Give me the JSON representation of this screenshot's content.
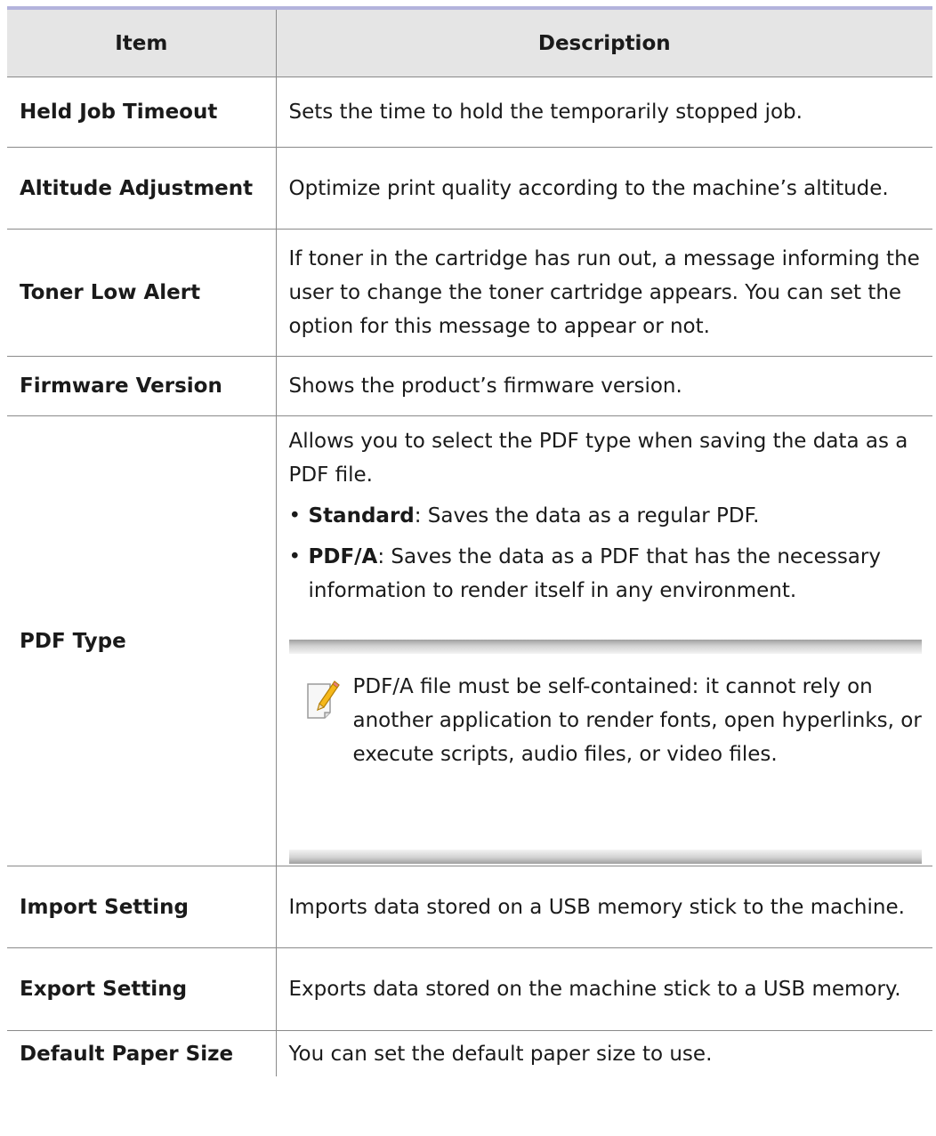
{
  "table": {
    "headers": {
      "item": "Item",
      "description": "Description"
    },
    "rows": [
      {
        "item": "Held Job Timeout",
        "description": "Sets the time to hold the temporarily stopped job."
      },
      {
        "item": "Altitude Adjustment",
        "description": "Optimize print quality according to the machine’s altitude."
      },
      {
        "item": "Toner Low Alert",
        "description": "If toner in the cartridge has run out, a message informing the user to change the toner cartridge appears. You can set the option for this message to appear or not."
      },
      {
        "item": "Firmware Version",
        "description": "Shows the product’s firmware version."
      },
      {
        "item": "PDF Type",
        "description": "Allows you to select the PDF type when saving the data as a PDF file.",
        "options": [
          {
            "name": "Standard",
            "text": ": Saves the data as a regular PDF."
          },
          {
            "name": "PDF/A",
            "text": ": Saves the data as a PDF that has the necessary information to render itself in any environment."
          }
        ],
        "note": {
          "icon": "note-pencil-icon",
          "text": "PDF/A file must be self-contained: it cannot rely on another application to render fonts, open hyperlinks, or execute scripts, audio files, or video files."
        }
      },
      {
        "item": "Import Setting",
        "description": "Imports data stored on a USB memory stick to the machine."
      },
      {
        "item": "Export Setting",
        "description": "Exports data stored on the machine stick to a USB memory."
      },
      {
        "item": "Default Paper Size",
        "description": "You can set the default paper size to use."
      }
    ]
  },
  "bullet_char": "•",
  "colors": {
    "header_bg": "#e5e5e5",
    "header_top_border": "#b3b3dc",
    "rule": "#8a8a8a"
  }
}
